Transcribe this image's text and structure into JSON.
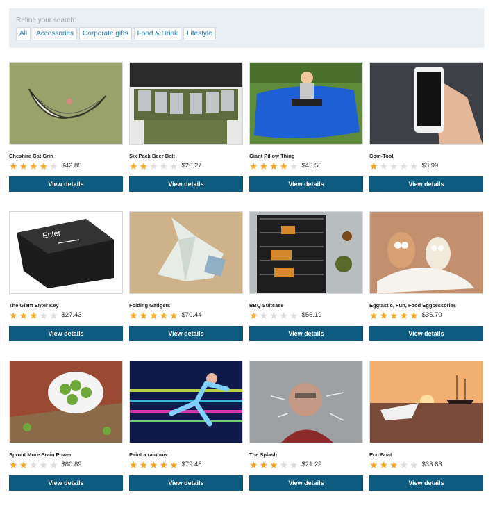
{
  "filters": {
    "title": "Refine your search:",
    "tags": [
      "All",
      "Accessories",
      "Corporate gifts",
      "Food & Drink",
      "Lifestyle"
    ]
  },
  "colors": {
    "button": "#0d5b81",
    "star_filled": "#f5a623",
    "star_empty": "#dcdcdc",
    "tag_text": "#1b7bb8"
  },
  "button_label": "View details",
  "products": [
    {
      "name": "Cheshire Cat Grin",
      "rating": 4,
      "price": "$42.85",
      "image": "cheshire-cat-grin-image"
    },
    {
      "name": "Six Pack Beer Belt",
      "rating": 2,
      "price": "$26.27",
      "image": "beer-belt-image"
    },
    {
      "name": "Giant Pillow Thing",
      "rating": 4,
      "price": "$45.58",
      "image": "giant-pillow-image"
    },
    {
      "name": "Com-Tool",
      "rating": 1,
      "price": "$8.99",
      "image": "phone-in-hand-image"
    },
    {
      "name": "The Giant Enter Key",
      "rating": 3,
      "price": "$27.43",
      "image": "enter-key-image"
    },
    {
      "name": "Folding Gadgets",
      "rating": 5,
      "price": "$70.44",
      "image": "origami-bird-image"
    },
    {
      "name": "BBQ Suitcase",
      "rating": 1,
      "price": "$55.19",
      "image": "bbq-grill-image"
    },
    {
      "name": "Eggtastic, Fun, Food Eggcessories",
      "rating": 5,
      "price": "$36.70",
      "image": "eggs-image"
    },
    {
      "name": "Sprout More Brain Power",
      "rating": 2,
      "price": "$80.89",
      "image": "brussels-sprouts-image"
    },
    {
      "name": "Paint a rainbow",
      "rating": 5,
      "price": "$79.45",
      "image": "rainbow-runner-image"
    },
    {
      "name": "The Splash",
      "rating": 3,
      "price": "$21.29",
      "image": "water-splash-image"
    },
    {
      "name": "Eco Boat",
      "rating": 3,
      "price": "$33.63",
      "image": "paper-boat-image"
    }
  ]
}
